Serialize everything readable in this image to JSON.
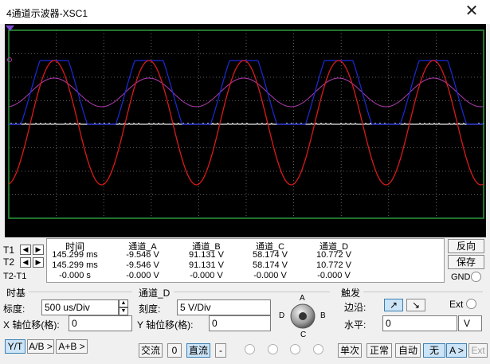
{
  "window": {
    "title": "4通道示波器-XSC1",
    "close_icon": "close-icon"
  },
  "screen": {
    "background": "#000000",
    "channels": [
      {
        "name": "A",
        "color": "#d91a1a",
        "waveform": "sine"
      },
      {
        "name": "B",
        "color": "#1a2bd9",
        "waveform": "clipped sine"
      },
      {
        "name": "C",
        "color": "#b03ab0",
        "waveform": "sine"
      },
      {
        "name": "D",
        "color": "#e8e8e8",
        "waveform": "flat"
      }
    ]
  },
  "cursors": {
    "t1_label": "T1",
    "t2_label": "T2",
    "t2t1_label": "T2-T1",
    "headers": [
      "时间",
      "通道_A",
      "通道_B",
      "通道_C",
      "通道_D"
    ],
    "rows": [
      [
        "145.299 ms",
        "-9.546 V",
        "91.131 V",
        "58.174 V",
        "10.772 V"
      ],
      [
        "145.299 ms",
        "-9.546 V",
        "91.131 V",
        "58.174 V",
        "10.772 V"
      ],
      [
        "-0.000 s",
        "-0.000 V",
        "-0.000 V",
        "-0.000 V",
        "-0.000 V"
      ]
    ]
  },
  "right_panel": {
    "reverse_label": "反向",
    "save_label": "保存",
    "gnd_label": "GND"
  },
  "timebase": {
    "group_label": "时基",
    "scale_label": "标度:",
    "scale_value": "500 us/Div",
    "x_offset_label": "X 轴位移(格):",
    "x_offset_value": "0",
    "modes": [
      "Y/T",
      "A/B >",
      "A+B >"
    ]
  },
  "channel": {
    "group_label": "通道_D",
    "scale_label": "刻度:",
    "scale_value": "5  V/Div",
    "y_offset_label": "Y 轴位移(格):",
    "y_offset_value": "0",
    "coupling": [
      "交流",
      "0",
      "直流",
      "-"
    ],
    "knob_labels": {
      "a": "A",
      "b": "B",
      "c": "C",
      "d": "D"
    }
  },
  "trigger": {
    "group_label": "触发",
    "edge_label": "边沿:",
    "ext_label": "Ext",
    "level_label": "水平:",
    "level_value": "0",
    "level_unit": "V",
    "modes": [
      "单次",
      "正常",
      "自动",
      "无",
      "A >",
      "Ext"
    ]
  }
}
